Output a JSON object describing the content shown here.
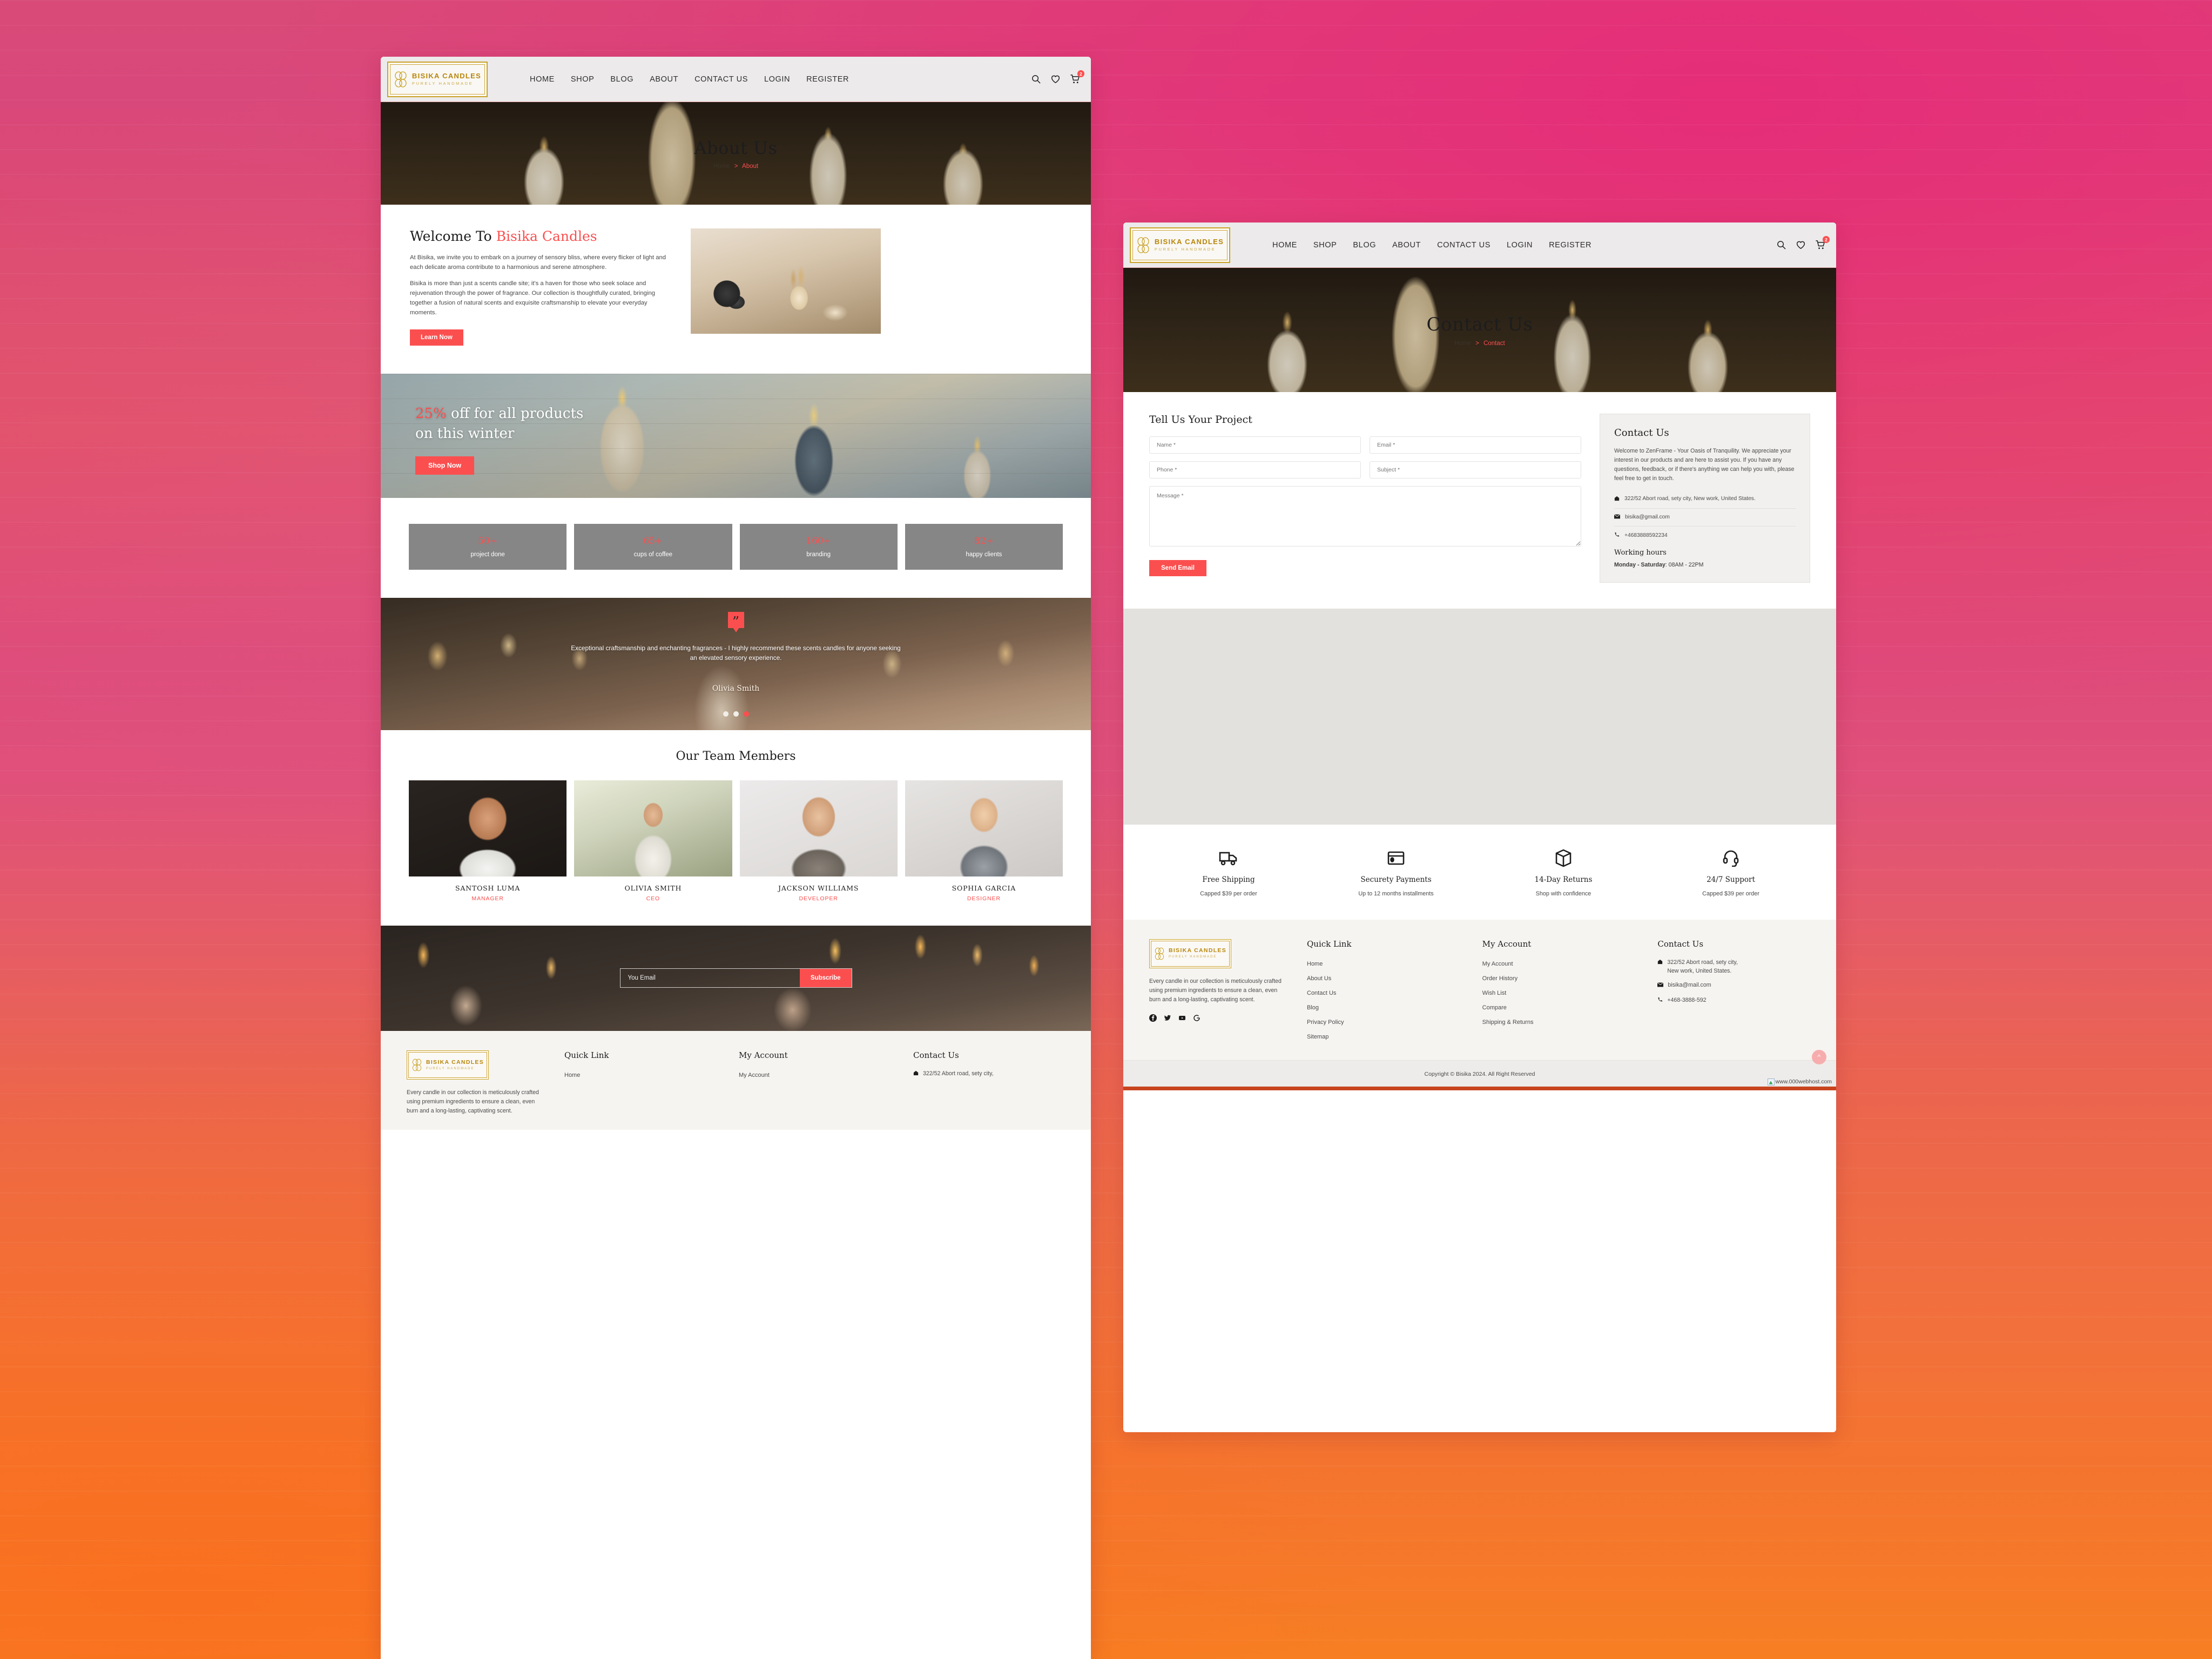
{
  "brand": {
    "name": "BISIKA CANDLES",
    "tagline": "PURELY HANDMADE",
    "accent_color": "#fb4f4f",
    "gold_color": "#b8860b"
  },
  "nav": {
    "items": [
      "HOME",
      "SHOP",
      "BLOG",
      "ABOUT",
      "CONTACT US",
      "LOGIN",
      "REGISTER"
    ],
    "icons": [
      "search-icon",
      "wishlist-heart-icon",
      "cart-icon"
    ],
    "cart_badge": "2"
  },
  "about_page": {
    "hero": {
      "title": "About Us",
      "breadcrumb_home": "Home",
      "breadcrumb_sep": ">",
      "breadcrumb_current": "About"
    },
    "welcome": {
      "title_plain": "Welcome To ",
      "title_accent": "Bisika Candles",
      "paragraph1": "At Bisika, we invite you to embark on a journey of sensory bliss, where every flicker of light and each delicate aroma contribute to a harmonious and serene atmosphere.",
      "paragraph2": "Bisika is more than just a scents candle site; it's a haven for those who seek solace and rejuvenation through the power of fragrance. Our collection is thoughtfully curated, bringing together a fusion of natural scents and exquisite craftsmanship to elevate your everyday moments.",
      "button": "Learn Now"
    },
    "promo": {
      "percent": "25%",
      "headline_rest": " off for all products",
      "headline_line2": "on this winter",
      "button": "Shop Now"
    },
    "stats": [
      {
        "number": "50+",
        "label": "project done"
      },
      {
        "number": "65+",
        "label": "cups of coffee"
      },
      {
        "number": "160+",
        "label": "branding"
      },
      {
        "number": "82+",
        "label": "happy clients"
      }
    ],
    "testimonial": {
      "quote": "Exceptional craftsmanship and enchanting fragrances - I highly recommend these scents candles for anyone seeking an elevated sensory experience.",
      "author": "Olivia Smith",
      "slide_count": 3,
      "active_slide": 3
    },
    "team": {
      "heading": "Our Team Members",
      "members": [
        {
          "name": "SANTOSH LUMA",
          "role": "MANAGER"
        },
        {
          "name": "OLIVIA SMITH",
          "role": "CEO"
        },
        {
          "name": "JACKSON WILLIAMS",
          "role": "DEVELOPER"
        },
        {
          "name": "SOPHIA GARCIA",
          "role": "DESIGNER"
        }
      ]
    },
    "newsletter": {
      "placeholder": "You Email",
      "button": "Subscribe"
    }
  },
  "contact_page": {
    "hero": {
      "title": "Contact Us",
      "breadcrumb_home": "Home",
      "breadcrumb_sep": ">",
      "breadcrumb_current": "Contact"
    },
    "form": {
      "heading": "Tell Us Your Project",
      "name_placeholder": "Name *",
      "email_placeholder": "Email *",
      "phone_placeholder": "Phone *",
      "subject_placeholder": "Subject *",
      "message_placeholder": "Message *",
      "submit": "Send Email"
    },
    "info_card": {
      "heading": "Contact Us",
      "body": "Welcome to ZenFrame - Your Oasis of Tranquility. We appreciate your interest in our products and are here to assist you. If you have any questions, feedback, or if there's anything we can help you with, please feel free to get in touch.",
      "address": "322/52 Abort road, sety city, New work, United States.",
      "email": "bisika@gmail.com",
      "phone": "+4683888592234",
      "hours_heading": "Working hours",
      "hours_days": "Monday - Saturday",
      "hours_time": "08AM - 22PM"
    },
    "features": [
      {
        "icon": "truck-icon",
        "title": "Free Shipping",
        "subtitle": "Capped $39 per order"
      },
      {
        "icon": "card-icon",
        "title": "Securety Payments",
        "subtitle": "Up to 12 months installments"
      },
      {
        "icon": "box-icon",
        "title": "14-Day Returns",
        "subtitle": "Shop with confidence"
      },
      {
        "icon": "headset-icon",
        "title": "24/7 Support",
        "subtitle": "Capped $39 per order"
      }
    ]
  },
  "footer": {
    "about": "Every candle in our collection is meticulously crafted using premium ingredients to ensure a clean, even burn and a long-lasting, captivating scent.",
    "socials": [
      "facebook-icon",
      "twitter-icon",
      "youtube-icon",
      "google-icon"
    ],
    "quick_link": {
      "heading": "Quick Link",
      "items": [
        "Home",
        "About Us",
        "Contact Us",
        "Blog",
        "Privacy Policy",
        "Sitemap"
      ]
    },
    "my_account": {
      "heading": "My Account",
      "items": [
        "My Account",
        "Order History",
        "Wish List",
        "Compare",
        "Shipping & Returns"
      ]
    },
    "contact": {
      "heading": "Contact Us",
      "address_line1": "322/52 Abort road, sety city,",
      "address_line2": "New work, United States.",
      "email": "bisika@mail.com",
      "phone": "+468-3888-592"
    },
    "copyright": "Copyright © Bisika 2024. All Right Reserved",
    "broken_image_alt": "www.000webhost.com"
  }
}
